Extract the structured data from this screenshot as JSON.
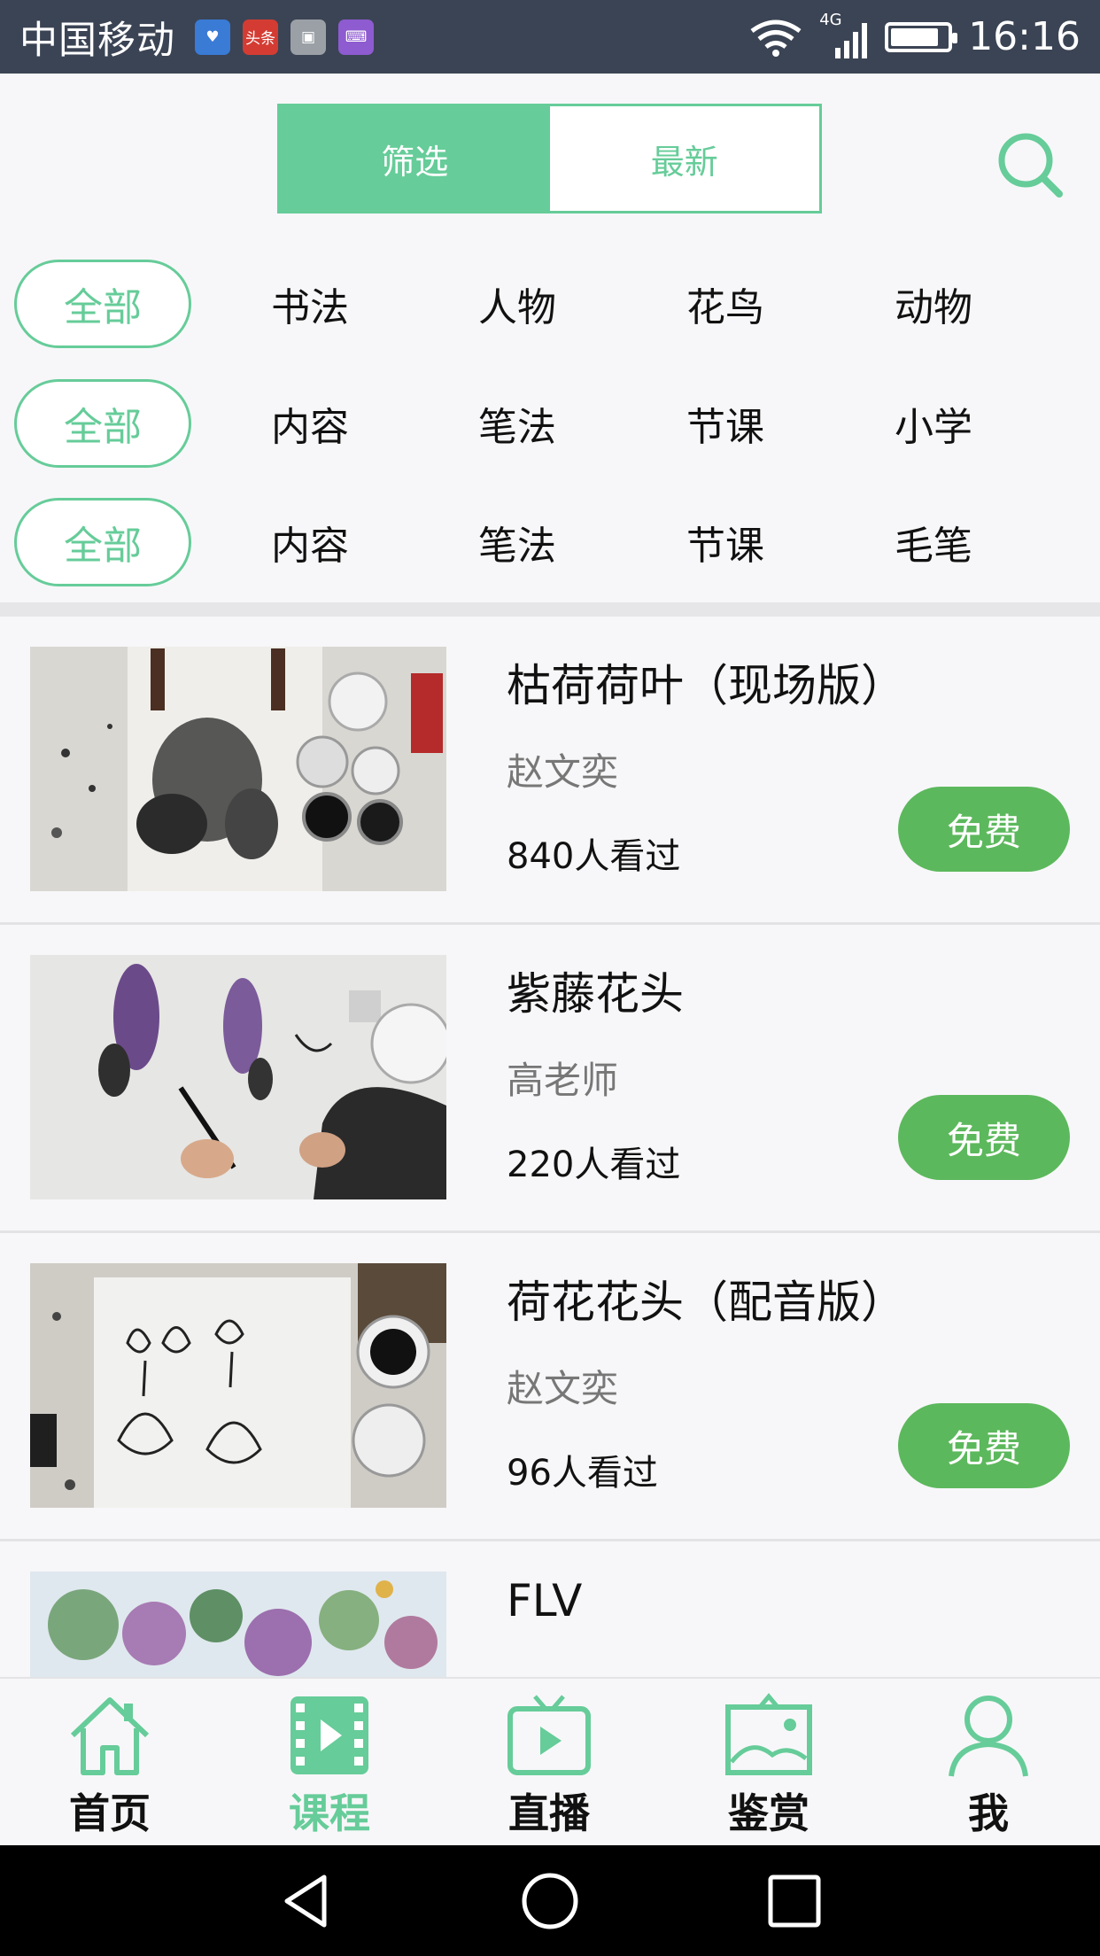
{
  "status_bar": {
    "carrier": "中国移动",
    "notification_apps": [
      {
        "icon": "health-app-icon",
        "color": "#3a7bd5",
        "glyph": "♥"
      },
      {
        "icon": "toutiao-app-icon",
        "color": "#d43c33",
        "glyph": "头条"
      },
      {
        "icon": "gallery-app-icon",
        "color": "#9aa0a6",
        "glyph": "▣"
      },
      {
        "icon": "keyboard-app-icon",
        "color": "#8e5bd0",
        "glyph": "⌨"
      }
    ],
    "network_type": "4G",
    "battery_level": 0.85,
    "time": "16:16"
  },
  "header": {
    "segment_tabs": [
      {
        "label": "筛选",
        "active": true
      },
      {
        "label": "最新",
        "active": false
      }
    ],
    "search_icon": "search-icon"
  },
  "filters": [
    {
      "selected": "全部",
      "options": [
        "书法",
        "人物",
        "花鸟",
        "动物"
      ]
    },
    {
      "selected": "全部",
      "options": [
        "内容",
        "笔法",
        "节课",
        "小学"
      ]
    },
    {
      "selected": "全部",
      "options": [
        "内容",
        "笔法",
        "节课",
        "毛笔"
      ]
    }
  ],
  "courses": [
    {
      "title": "枯荷荷叶（现场版）",
      "author": "赵文奕",
      "views": "840人看过",
      "price_label": "免费"
    },
    {
      "title": "紫藤花头",
      "author": "高老师",
      "views": "220人看过",
      "price_label": "免费"
    },
    {
      "title": "荷花花头（配音版）",
      "author": "赵文奕",
      "views": "96人看过",
      "price_label": "免费"
    },
    {
      "title": "FLV",
      "author": "",
      "views": "",
      "price_label": ""
    }
  ],
  "tabbar": {
    "items": [
      {
        "label": "首页",
        "icon": "home-icon",
        "active": false
      },
      {
        "label": "课程",
        "icon": "film-icon",
        "active": true
      },
      {
        "label": "直播",
        "icon": "tv-play-icon",
        "active": false
      },
      {
        "label": "鉴赏",
        "icon": "picture-frame-icon",
        "active": false
      },
      {
        "label": "我",
        "icon": "person-icon",
        "active": false
      }
    ]
  },
  "colors": {
    "accent": "#66cc99",
    "free_button": "#5cb85c",
    "status_bar": "#3b4454"
  }
}
